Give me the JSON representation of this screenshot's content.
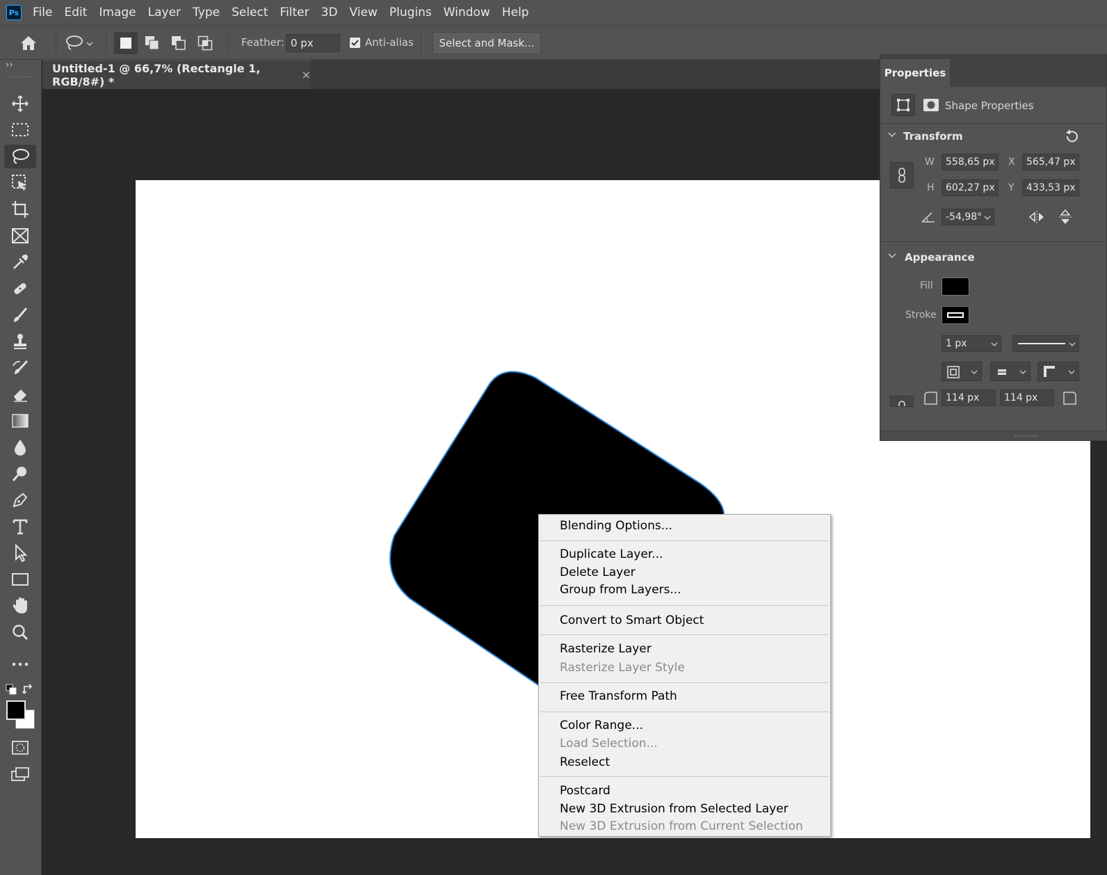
{
  "app": {
    "logo_text": "Ps",
    "menu": [
      "File",
      "Edit",
      "Image",
      "Layer",
      "Type",
      "Select",
      "Filter",
      "3D",
      "View",
      "Plugins",
      "Window",
      "Help"
    ]
  },
  "options": {
    "feather_label": "Feather:",
    "feather_value": "0 px",
    "antialias_label": "Anti-alias",
    "antialias_checked": true,
    "select_mask_label": "Select and Mask..."
  },
  "toolbar": {
    "collapse_glyph": "››"
  },
  "document": {
    "tab_title": "Untitled-1 @ 66,7% (Rectangle 1, RGB/8#) *",
    "tab_close": "×"
  },
  "properties": {
    "tab": "Properties",
    "shape_label": "Shape Properties",
    "transform": {
      "title": "Transform",
      "w_label": "W",
      "w_value": "558,65 px",
      "h_label": "H",
      "h_value": "602,27 px",
      "x_label": "X",
      "x_value": "565,47 px",
      "y_label": "Y",
      "y_value": "433,53 px",
      "angle_value": "-54,98°"
    },
    "appearance": {
      "title": "Appearance",
      "fill_label": "Fill",
      "stroke_label": "Stroke",
      "stroke_width": "1 px",
      "fill_color": "#000000",
      "corner_1": "114 px",
      "corner_2": "114 px"
    }
  },
  "context_menu": {
    "items": [
      {
        "label": "Blending Options...",
        "disabled": false
      },
      {
        "label": "Duplicate Layer...",
        "disabled": false
      },
      {
        "label": "Delete Layer",
        "disabled": false
      },
      {
        "label": "Group from Layers...",
        "disabled": false
      },
      {
        "label": "Convert to Smart Object",
        "disabled": false
      },
      {
        "label": "Rasterize Layer",
        "disabled": false
      },
      {
        "label": "Rasterize Layer Style",
        "disabled": true
      },
      {
        "label": "Free Transform Path",
        "disabled": false
      },
      {
        "label": "Color Range...",
        "disabled": false
      },
      {
        "label": "Load Selection...",
        "disabled": true
      },
      {
        "label": "Reselect",
        "disabled": false
      },
      {
        "label": "Postcard",
        "disabled": false
      },
      {
        "label": "New 3D Extrusion from Selected Layer",
        "disabled": false
      },
      {
        "label": "New 3D Extrusion from Current Selection",
        "disabled": true
      }
    ]
  },
  "colors": {
    "chrome": "#535353",
    "canvas_bg": "#282828",
    "accent": "#31a8ff",
    "selection_outline": "#2a86d8"
  }
}
